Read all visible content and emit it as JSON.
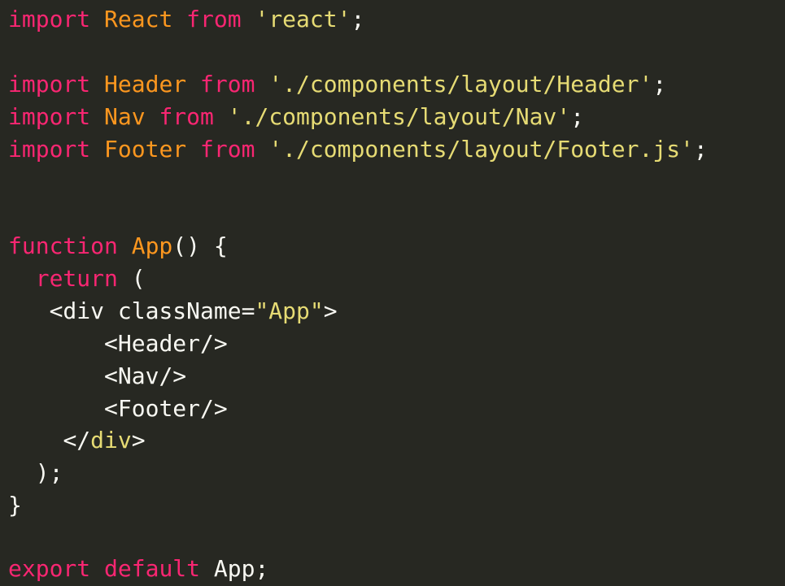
{
  "colors": {
    "background": "#272822",
    "keyword": "#f92672",
    "identifier": "#fd971f",
    "string": "#e6db74",
    "function": "#a6e22e",
    "plain": "#f8f8f2"
  },
  "code": {
    "line1": {
      "import": "import",
      "name": "React",
      "from": "from",
      "module": "'react'",
      "end": ";"
    },
    "line3": {
      "import": "import",
      "name": "Header",
      "from": "from",
      "module": "'./components/layout/Header'",
      "end": ";"
    },
    "line4": {
      "import": "import",
      "name": "Nav",
      "from": "from",
      "module": "'./components/layout/Nav'",
      "end": ";"
    },
    "line5": {
      "import": "import",
      "name": "Footer",
      "from": "from",
      "module": "'./components/layout/Footer.js'",
      "end": ";"
    },
    "line8": {
      "keyword": "function",
      "name": "App",
      "parens": "()",
      "brace": " {"
    },
    "line9": {
      "keyword": "return",
      "paren": " ("
    },
    "line10": {
      "open": "<div ",
      "attr": "className=",
      "value": "\"App\"",
      "close": ">"
    },
    "line11": {
      "tag": "<Header/>"
    },
    "line12": {
      "tag": "<Nav/>"
    },
    "line13": {
      "tag": "<Footer/>"
    },
    "line14": {
      "open": "</",
      "name": "div",
      "close": ">"
    },
    "line15": {
      "text": ");"
    },
    "line16": {
      "text": "}"
    },
    "line18": {
      "export": "export",
      "default": "default",
      "name": "App",
      "end": ";"
    }
  }
}
